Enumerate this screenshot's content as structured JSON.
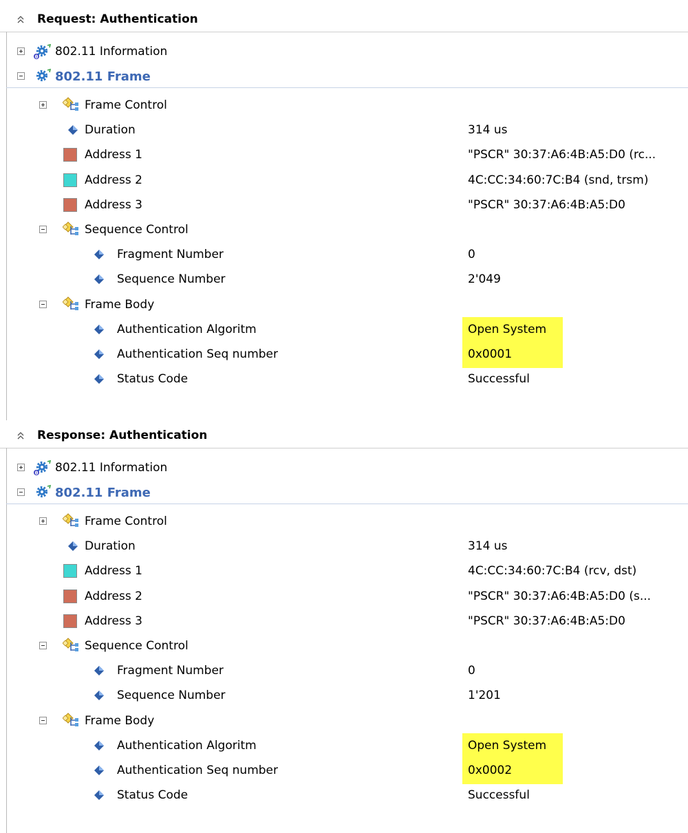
{
  "colors": {
    "highlight": "#ffff4c",
    "frame_title": "#3d68b4",
    "address_receiver": "#cf6d58",
    "address_sender": "#3fd7d2"
  },
  "sections": [
    {
      "header": "Request: Authentication",
      "info_label": "802.11 Information",
      "frame_label": "802.11 Frame",
      "frame_control": "Frame Control",
      "duration": {
        "label": "Duration",
        "value": "314 us"
      },
      "address1": {
        "label": "Address 1",
        "value": "\"PSCR\" 30:37:A6:4B:A5:D0 (rc...",
        "color": "#cf6d58"
      },
      "address2": {
        "label": "Address 2",
        "value": "4C:CC:34:60:7C:B4 (snd, trsm)",
        "color": "#3fd7d2"
      },
      "address3": {
        "label": "Address 3",
        "value": "\"PSCR\" 30:37:A6:4B:A5:D0",
        "color": "#cf6d58"
      },
      "sequence_control": "Sequence Control",
      "fragment": {
        "label": "Fragment Number",
        "value": "0"
      },
      "sequence": {
        "label": "Sequence Number",
        "value": "2'049"
      },
      "frame_body": "Frame Body",
      "algorithm": {
        "label": "Authentication Algoritm",
        "value": "Open System"
      },
      "seq_number": {
        "label": "Authentication Seq number",
        "value": "0x0001"
      },
      "status": {
        "label": "Status Code",
        "value": "Successful"
      }
    },
    {
      "header": "Response: Authentication",
      "info_label": "802.11 Information",
      "frame_label": "802.11 Frame",
      "frame_control": "Frame Control",
      "duration": {
        "label": "Duration",
        "value": "314 us"
      },
      "address1": {
        "label": "Address 1",
        "value": "4C:CC:34:60:7C:B4 (rcv, dst)",
        "color": "#3fd7d2"
      },
      "address2": {
        "label": "Address 2",
        "value": "\"PSCR\" 30:37:A6:4B:A5:D0 (s...",
        "color": "#cf6d58"
      },
      "address3": {
        "label": "Address 3",
        "value": "\"PSCR\" 30:37:A6:4B:A5:D0",
        "color": "#cf6d58"
      },
      "sequence_control": "Sequence Control",
      "fragment": {
        "label": "Fragment Number",
        "value": "0"
      },
      "sequence": {
        "label": "Sequence Number",
        "value": "1'201"
      },
      "frame_body": "Frame Body",
      "algorithm": {
        "label": "Authentication Algoritm",
        "value": "Open System"
      },
      "seq_number": {
        "label": "Authentication Seq number",
        "value": "0x0002"
      },
      "status": {
        "label": "Status Code",
        "value": "Successful"
      }
    }
  ]
}
